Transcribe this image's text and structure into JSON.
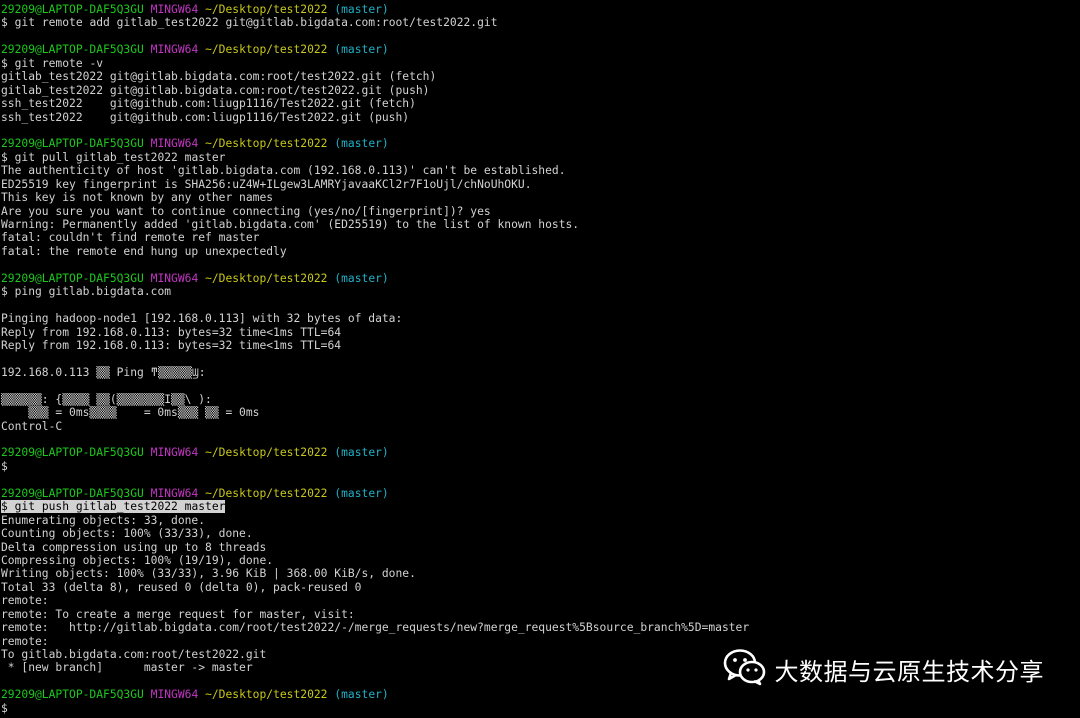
{
  "terminal": {
    "prompt": {
      "user_host": "29209@LAPTOP-DAF5Q3GU",
      "system": "MINGW64",
      "path": "~/Desktop/test2022",
      "branch": "(master)",
      "symbol": "$"
    },
    "sessions": [
      {
        "command": "git remote add gitlab_test2022 git@gitlab.bigdata.com:root/test2022.git",
        "output": []
      },
      {
        "command": "git remote -v",
        "output": [
          "gitlab_test2022 git@gitlab.bigdata.com:root/test2022.git (fetch)",
          "gitlab_test2022 git@gitlab.bigdata.com:root/test2022.git (push)",
          "ssh_test2022    git@github.com:liugp1116/Test2022.git (fetch)",
          "ssh_test2022    git@github.com:liugp1116/Test2022.git (push)"
        ]
      },
      {
        "command": "git pull gitlab_test2022 master",
        "output": [
          "The authenticity of host 'gitlab.bigdata.com (192.168.0.113)' can't be established.",
          "ED25519 key fingerprint is SHA256:uZ4W+ILgew3LAMRYjavaaKCl2r7F1oUjl/chNoUhOKU.",
          "This key is not known by any other names",
          "Are you sure you want to continue connecting (yes/no/[fingerprint])? yes",
          "Warning: Permanently added 'gitlab.bigdata.com' (ED25519) to the list of known hosts.",
          "fatal: couldn't find remote ref master",
          "fatal: the remote end hung up unexpectedly"
        ]
      },
      {
        "command": "ping gitlab.bigdata.com",
        "output": [
          "",
          "Pinging hadoop-node1 [192.168.0.113] with 32 bytes of data:",
          "Reply from 192.168.0.113: bytes=32 time<1ms TTL=64",
          "Reply from 192.168.0.113: bytes=32 time<1ms TTL=64",
          "",
          "192.168.0.113 ▒▒ Ping ͳ▒▒▒▒▒Ϣ:",
          "",
          "▒▒▒▒▒▒: {▒▒▒▒ ▒▒(▒▒▒▒▒▒▒I▒▒\\ ):",
          "    ▒▒▒ = 0ms▒▒▒▒    = 0ms▒▒▒ ▒▒ = 0ms",
          "Control-C"
        ]
      },
      {
        "command": "",
        "output": []
      },
      {
        "command": "git push gitlab_test2022 master",
        "highlight": true,
        "output": [
          "Enumerating objects: 33, done.",
          "Counting objects: 100% (33/33), done.",
          "Delta compression using up to 8 threads",
          "Compressing objects: 100% (19/19), done.",
          "Writing objects: 100% (33/33), 3.96 KiB | 368.00 KiB/s, done.",
          "Total 33 (delta 8), reused 0 (delta 0), pack-reused 0",
          "remote:",
          "remote: To create a merge request for master, visit:",
          "remote:   http://gitlab.bigdata.com/root/test2022/-/merge_requests/new?merge_request%5Bsource_branch%5D=master",
          "remote:",
          "To gitlab.bigdata.com:root/test2022.git",
          " * [new branch]      master -> master"
        ]
      },
      {
        "command": "",
        "output": [],
        "last": true
      }
    ]
  },
  "watermark": {
    "icon": "wechat-icon",
    "text": "大数据与云原生技术分享"
  },
  "colors": {
    "background": "#000000",
    "foreground": "#d2d2d2",
    "user_host": "#1cc81c",
    "system": "#c236c2",
    "path": "#c8c81c",
    "branch": "#1fb0c6"
  }
}
